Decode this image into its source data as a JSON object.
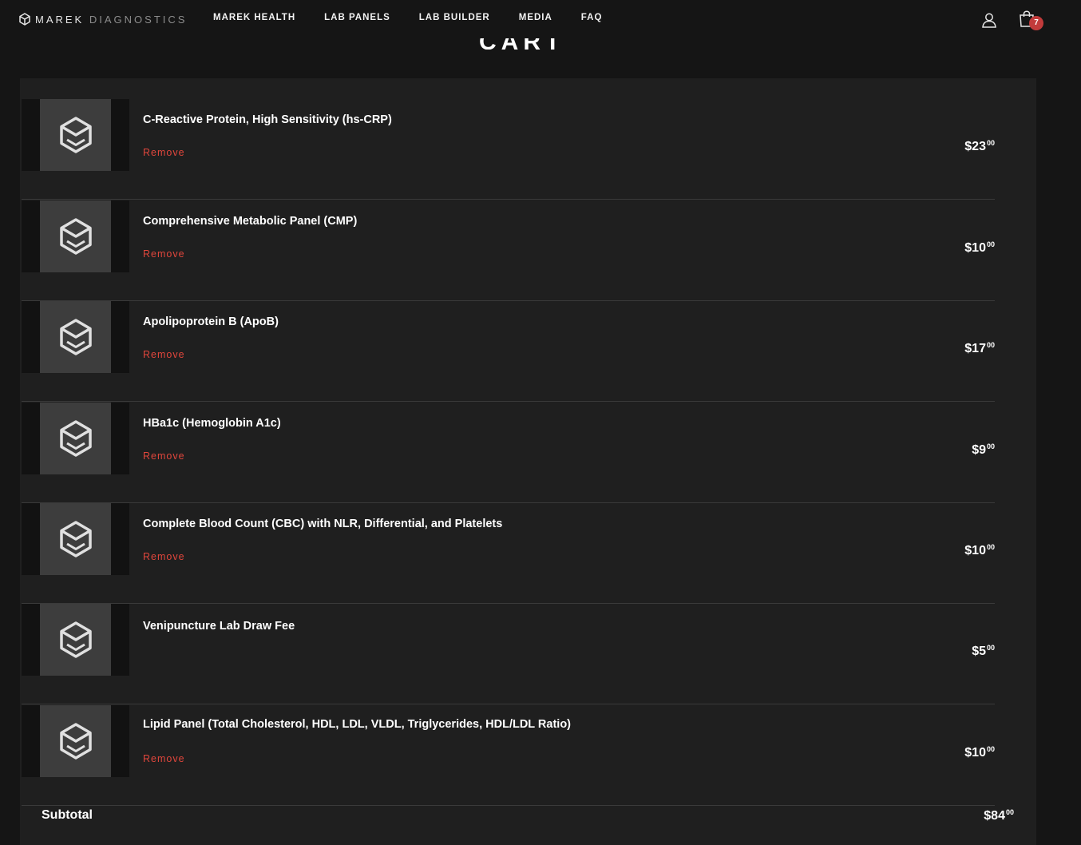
{
  "brand": {
    "word1": "MAREK",
    "word2": "DIAGNOSTICS"
  },
  "nav": [
    "MAREK HEALTH",
    "LAB PANELS",
    "LAB BUILDER",
    "MEDIA",
    "FAQ"
  ],
  "header": {
    "cart_count": "7",
    "page_title": "CART"
  },
  "cart": {
    "remove_label": "Remove",
    "items": [
      {
        "name": "C-Reactive Protein, High Sensitivity (hs-CRP)",
        "price_main": "$23",
        "price_cents": "00",
        "removable": true
      },
      {
        "name": "Comprehensive Metabolic Panel (CMP)",
        "price_main": "$10",
        "price_cents": "00",
        "removable": true
      },
      {
        "name": "Apolipoprotein B (ApoB)",
        "price_main": "$17",
        "price_cents": "00",
        "removable": true
      },
      {
        "name": "HBa1c (Hemoglobin A1c)",
        "price_main": "$9",
        "price_cents": "00",
        "removable": true
      },
      {
        "name": "Complete Blood Count (CBC) with NLR, Differential, and Platelets",
        "price_main": "$10",
        "price_cents": "00",
        "removable": true
      },
      {
        "name": "Venipuncture Lab Draw Fee",
        "price_main": "$5",
        "price_cents": "00",
        "removable": false
      },
      {
        "name": "Lipid Panel (Total Cholesterol, HDL, LDL, VLDL, Triglycerides, HDL/LDL Ratio)",
        "price_main": "$10",
        "price_cents": "00",
        "removable": true
      }
    ],
    "subtotal_label": "Subtotal",
    "subtotal_main": "$84",
    "subtotal_cents": "00"
  },
  "icons": {
    "product": "cube-icon",
    "account": "user-icon",
    "cart": "shopping-bag-icon",
    "logo": "logo-cube-icon"
  },
  "colors": {
    "remove": "#e0463c",
    "badge": "#c23b3b",
    "panel": "#1f1f1f",
    "background": "#151515"
  }
}
